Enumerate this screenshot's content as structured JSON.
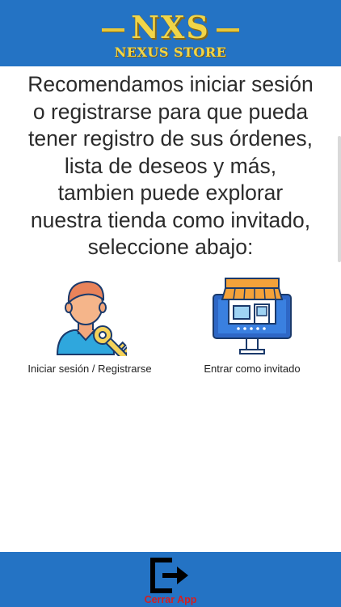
{
  "header": {
    "logo_big": "NXS",
    "logo_small": "NEXUS STORE"
  },
  "main": {
    "message": "Recomendamos iniciar sesión o registrarse para que pueda tener registro de sus órdenes, lista de deseos y más, tambien puede explorar nuestra tienda como invitado, seleccione abajo:",
    "options": [
      {
        "label": "Iniciar sesión / Registrarse",
        "icon": "user-key-icon"
      },
      {
        "label": "Entrar como invitado",
        "icon": "storefront-monitor-icon"
      }
    ]
  },
  "footer": {
    "exit_label": "Cerrar App",
    "icon": "exit-icon"
  },
  "colors": {
    "bar_blue": "#2473c4",
    "logo_gold": "#f1d548",
    "exit_red": "#d81e1e"
  }
}
